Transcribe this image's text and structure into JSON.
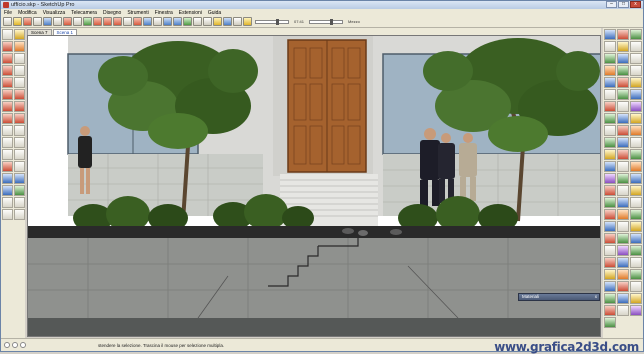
{
  "window": {
    "title": "uffício.skp - SketchUp Pro",
    "buttons": {
      "minimize": "–",
      "maximize": "□",
      "close": "x"
    }
  },
  "menu": {
    "items": [
      "File",
      "Modifica",
      "Visualizza",
      "Telecamera",
      "Disegno",
      "Strumenti",
      "Finestra",
      "Estensioni",
      "Guida"
    ]
  },
  "toolbar": {
    "shadow_time": "07:41",
    "shadow_date": "Mezzo",
    "icons": [
      "select-icon",
      "component-icon",
      "paint-icon",
      "erase-icon",
      "rectangle-icon",
      "line-icon",
      "circle-icon",
      "arc-icon",
      "polygon-icon",
      "pushpull-icon",
      "move-icon",
      "rotate-icon",
      "scale-icon",
      "offset-icon",
      "orbit-icon",
      "pan-icon",
      "zoom-icon",
      "zoom-extents-icon",
      "xray-icon",
      "wireframe-icon",
      "hidden-line-icon",
      "shaded-icon",
      "textured-icon",
      "monochrome-icon",
      "shadows-icon"
    ]
  },
  "scenes": {
    "tabs": [
      {
        "label": "Scena 7",
        "active": false
      },
      {
        "label": "Scena 1",
        "active": true
      }
    ]
  },
  "panel": {
    "materials_title": "Materiali",
    "close": "x"
  },
  "status": {
    "message": "stendere la selezione. Trascina il mouse per selezione multipla."
  },
  "watermark": {
    "text": "www.grafica2d3d.com"
  },
  "colors": {
    "sky_glass": "#9fb3c3",
    "door": "#a5622e",
    "stone_wall": "#c9ccc7",
    "concrete": "#8f918e",
    "tree_green": "#3a5f22"
  }
}
